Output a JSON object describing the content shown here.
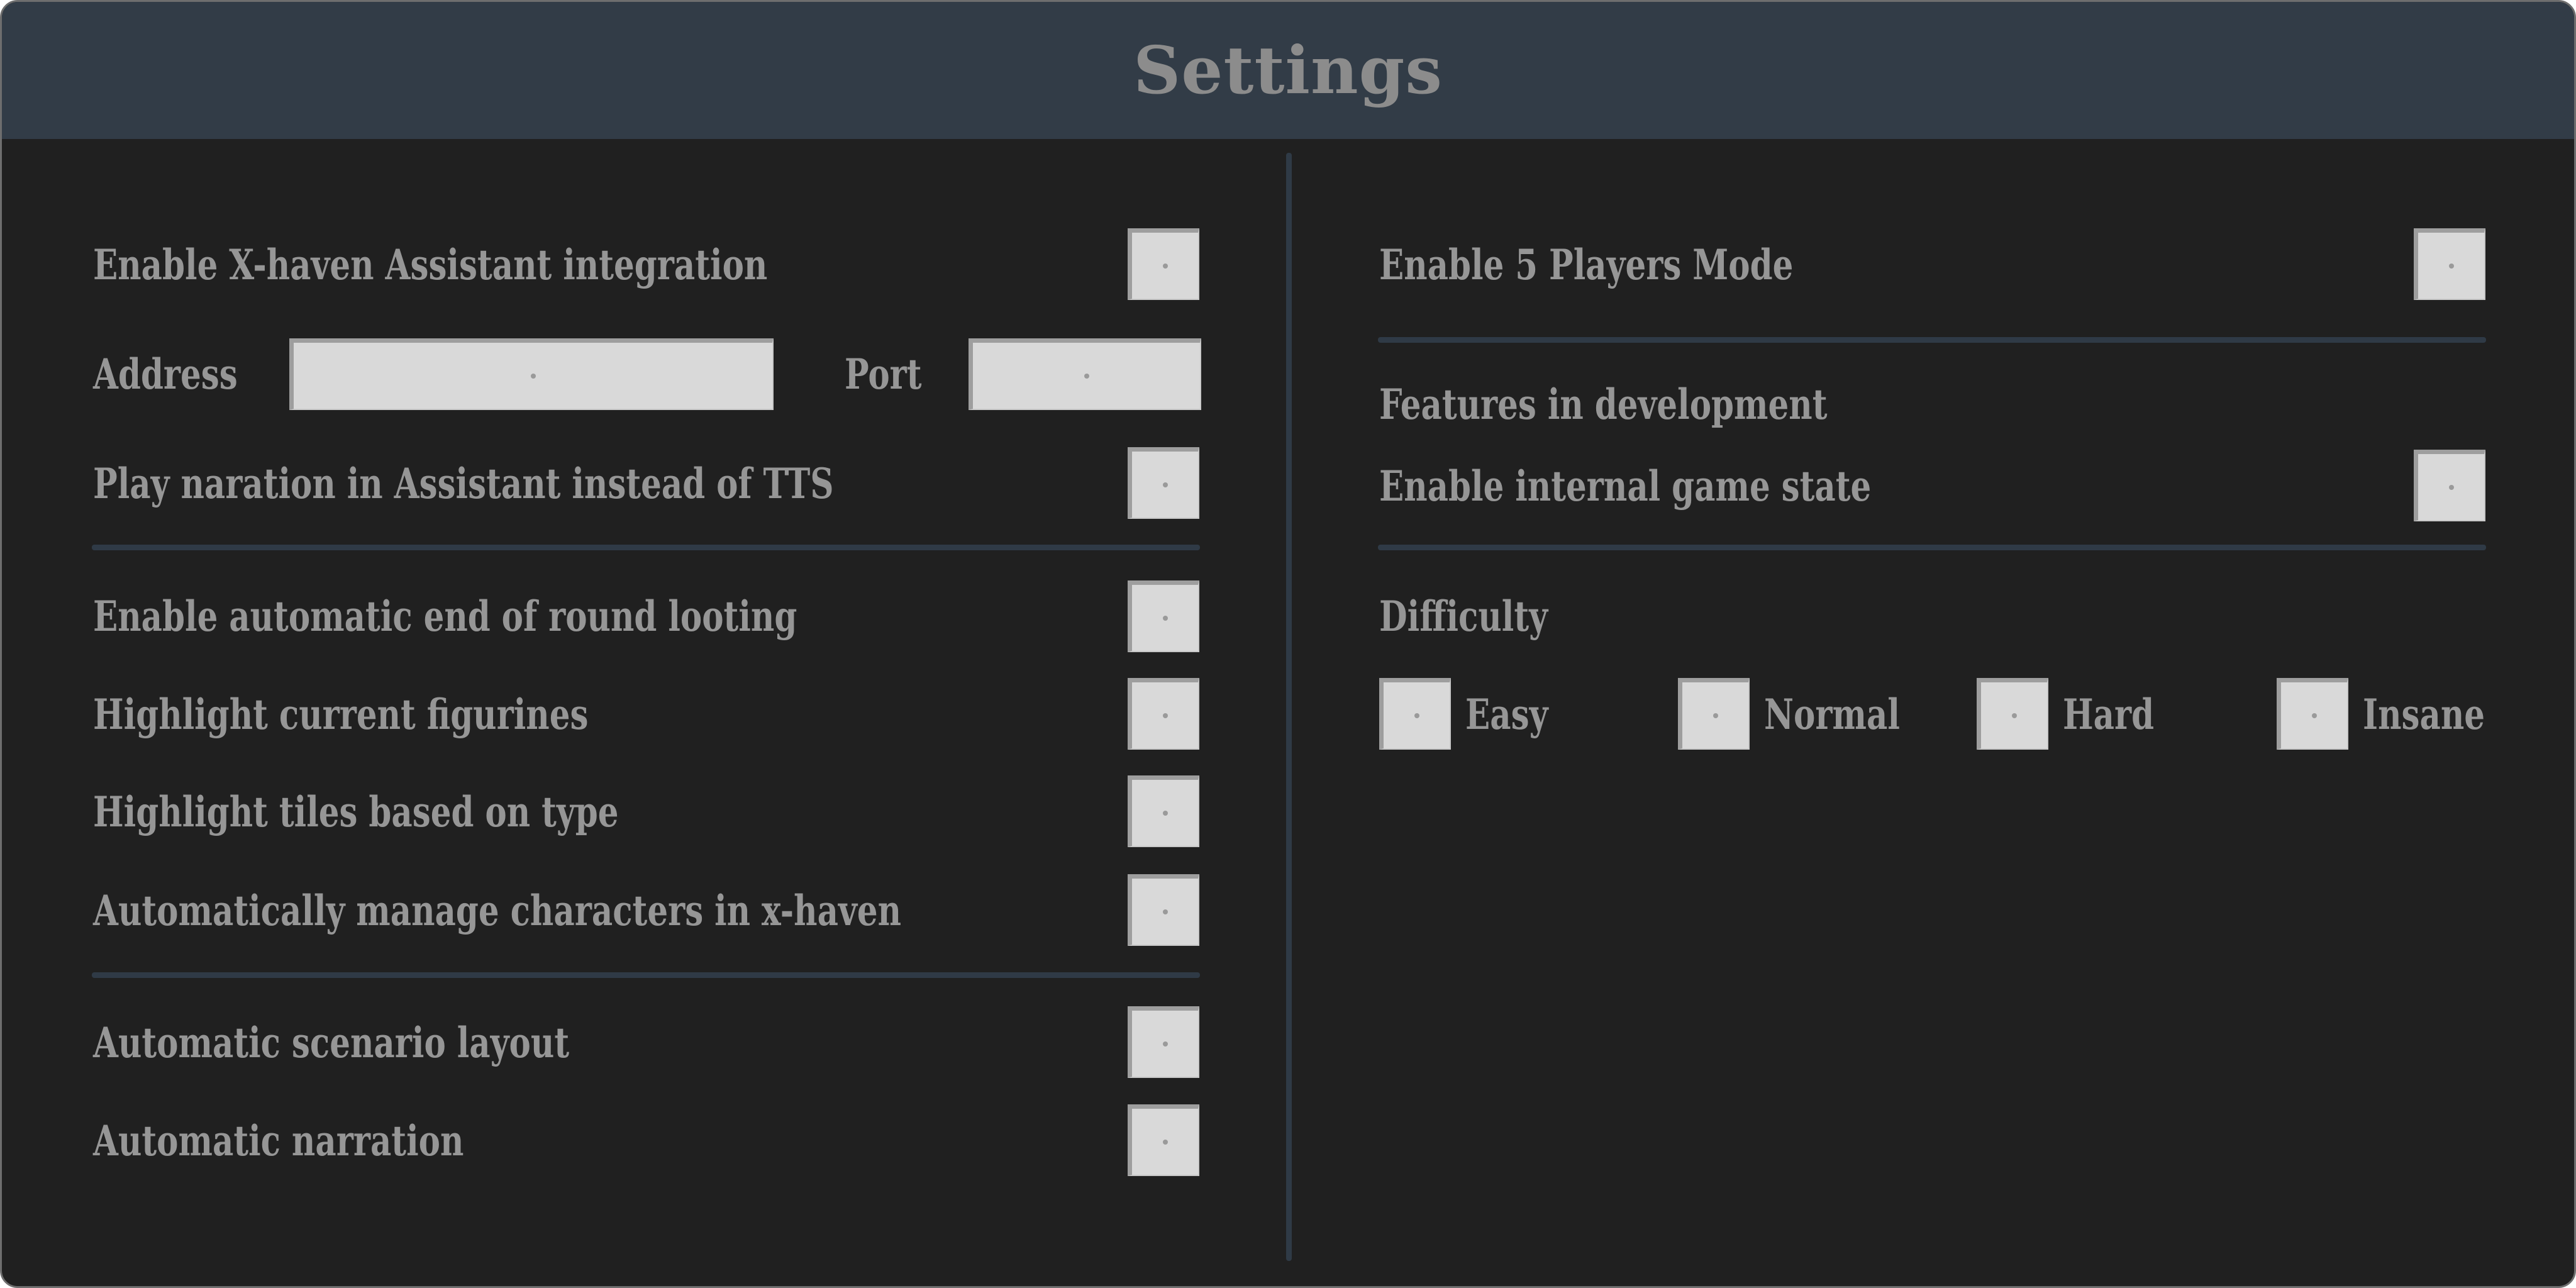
{
  "window": {
    "title": "Settings"
  },
  "left": {
    "assistant": {
      "enable_label": "Enable X-haven Assistant integration",
      "address_label": "Address",
      "address_value": "",
      "port_label": "Port",
      "port_value": "",
      "play_narration_label": "Play naration in Assistant instead of TTS"
    },
    "gameplay": {
      "auto_looting_label": "Enable automatic end of round looting",
      "highlight_figurines_label": "Highlight current figurines",
      "highlight_tiles_label": "Highlight tiles based on type",
      "manage_characters_label": "Automatically manage characters in x-haven"
    },
    "automation": {
      "scenario_layout_label": "Automatic scenario layout",
      "narration_label": "Automatic narration"
    }
  },
  "right": {
    "five_players_label": "Enable 5 Players Mode",
    "dev_heading": "Features in development",
    "internal_state_label": "Enable internal game state",
    "difficulty": {
      "heading": "Difficulty",
      "options": [
        "Easy",
        "Normal",
        "Hard",
        "Insane"
      ]
    }
  },
  "colors": {
    "background": "#202020",
    "header": "#323c47",
    "separator": "#2f3a46",
    "text": "#969696",
    "control": "#d9d9d9"
  }
}
